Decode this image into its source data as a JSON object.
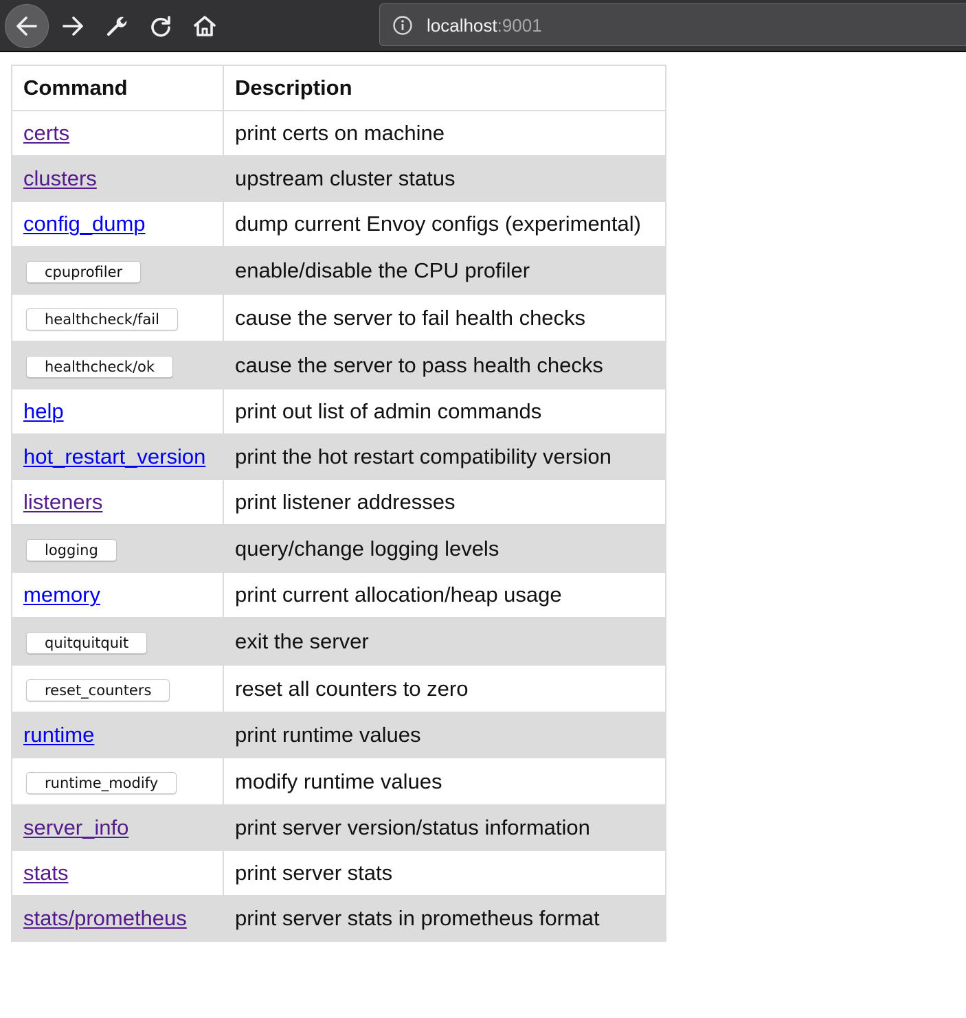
{
  "browser": {
    "url_host": "localhost",
    "url_port": ":9001"
  },
  "table": {
    "headers": [
      "Command",
      "Description"
    ],
    "rows": [
      {
        "command": "certs",
        "description": "print certs on machine",
        "kind": "link",
        "visited": true
      },
      {
        "command": "clusters",
        "description": "upstream cluster status",
        "kind": "link",
        "visited": true
      },
      {
        "command": "config_dump",
        "description": "dump current Envoy configs (experimental)",
        "kind": "link",
        "visited": false
      },
      {
        "command": "cpuprofiler",
        "description": "enable/disable the CPU profiler",
        "kind": "button"
      },
      {
        "command": "healthcheck/fail",
        "description": "cause the server to fail health checks",
        "kind": "button"
      },
      {
        "command": "healthcheck/ok",
        "description": "cause the server to pass health checks",
        "kind": "button"
      },
      {
        "command": "help",
        "description": "print out list of admin commands",
        "kind": "link",
        "visited": false
      },
      {
        "command": "hot_restart_version",
        "description": "print the hot restart compatibility version",
        "kind": "link",
        "visited": false
      },
      {
        "command": "listeners",
        "description": "print listener addresses",
        "kind": "link",
        "visited": true
      },
      {
        "command": "logging",
        "description": "query/change logging levels",
        "kind": "button"
      },
      {
        "command": "memory",
        "description": "print current allocation/heap usage",
        "kind": "link",
        "visited": false
      },
      {
        "command": "quitquitquit",
        "description": "exit the server",
        "kind": "button"
      },
      {
        "command": "reset_counters",
        "description": "reset all counters to zero",
        "kind": "button"
      },
      {
        "command": "runtime",
        "description": "print runtime values",
        "kind": "link",
        "visited": false
      },
      {
        "command": "runtime_modify",
        "description": "modify runtime values",
        "kind": "button"
      },
      {
        "command": "server_info",
        "description": "print server version/status information",
        "kind": "link",
        "visited": true
      },
      {
        "command": "stats",
        "description": "print server stats",
        "kind": "link",
        "visited": true
      },
      {
        "command": "stats/prometheus",
        "description": "print server stats in prometheus format",
        "kind": "link",
        "visited": true
      }
    ]
  },
  "colors": {
    "toolbar_bg": "#323234",
    "row_shade": "#dcdcdc",
    "link_visited": "#551a8b",
    "link_unvisited": "#0000ee"
  },
  "icons": [
    "back-arrow-icon",
    "forward-arrow-icon",
    "wrench-icon",
    "reload-icon",
    "home-icon",
    "info-icon"
  ]
}
